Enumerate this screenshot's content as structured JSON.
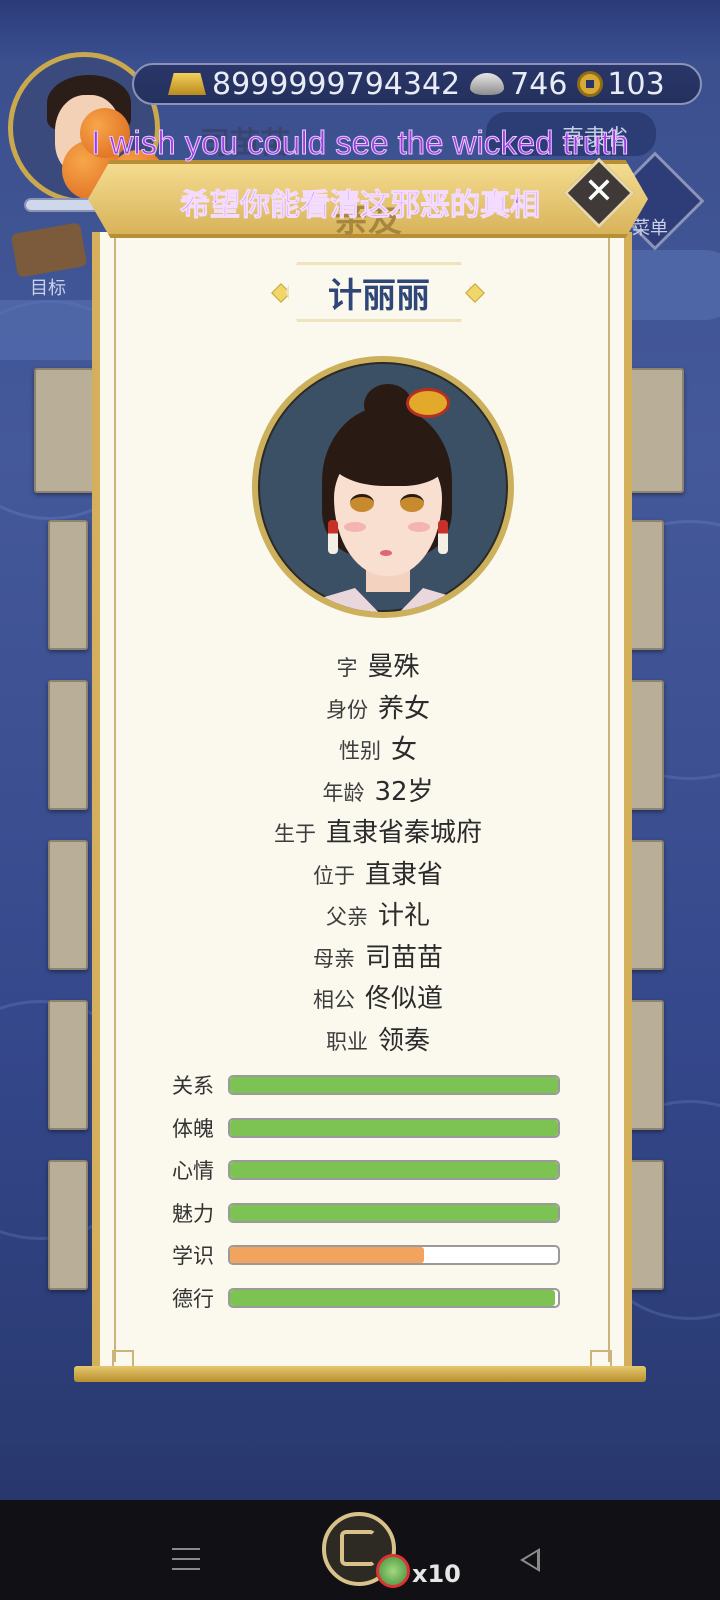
{
  "hud": {
    "currency": {
      "gold": "8999999794342",
      "silver": "746",
      "coins": "103"
    },
    "player_name": "司苗苗",
    "location": "直隶省",
    "menu_label": "菜单",
    "goal_label": "目标"
  },
  "subtitles": {
    "english": "I wish you could see the wicked truth",
    "chinese": "希望你能看清这邪恶的真相"
  },
  "panel": {
    "header_title": "亲友",
    "close_icon": "✕",
    "name": "计丽丽",
    "info": [
      {
        "label": "字",
        "value": "曼殊"
      },
      {
        "label": "身份",
        "value": "养女"
      },
      {
        "label": "性别",
        "value": "女"
      },
      {
        "label": "年龄",
        "value": "32岁"
      },
      {
        "label": "生于",
        "value": "直隶省秦城府"
      },
      {
        "label": "位于",
        "value": "直隶省"
      },
      {
        "label": "父亲",
        "value": "计礼"
      },
      {
        "label": "母亲",
        "value": "司苗苗"
      },
      {
        "label": "相公",
        "value": "佟似道"
      },
      {
        "label": "职业",
        "value": "领奏"
      }
    ],
    "stats": [
      {
        "label": "关系",
        "fraction": 1.0,
        "color": "#7cc354"
      },
      {
        "label": "体魄",
        "fraction": 1.0,
        "color": "#7cc354"
      },
      {
        "label": "心情",
        "fraction": 1.0,
        "color": "#7cc354"
      },
      {
        "label": "魅力",
        "fraction": 1.0,
        "color": "#7cc354"
      },
      {
        "label": "学识",
        "fraction": 0.59,
        "color": "#f2a35e"
      },
      {
        "label": "德行",
        "fraction": 0.99,
        "color": "#7cc354"
      }
    ]
  },
  "bottom": {
    "reward_count": "x10"
  },
  "colors": {
    "panel_border": "#d4b05d",
    "name_text": "#2f4778",
    "subtitle": "#9b3fe0",
    "bar_green": "#7cc354",
    "bar_orange": "#f2a35e"
  },
  "icons": [
    "gold-bar-icon",
    "silver-ingot-icon",
    "copper-coin-icon",
    "close-icon",
    "share-icon",
    "jade-pendant-icon",
    "menu-icon",
    "back-icon"
  ]
}
